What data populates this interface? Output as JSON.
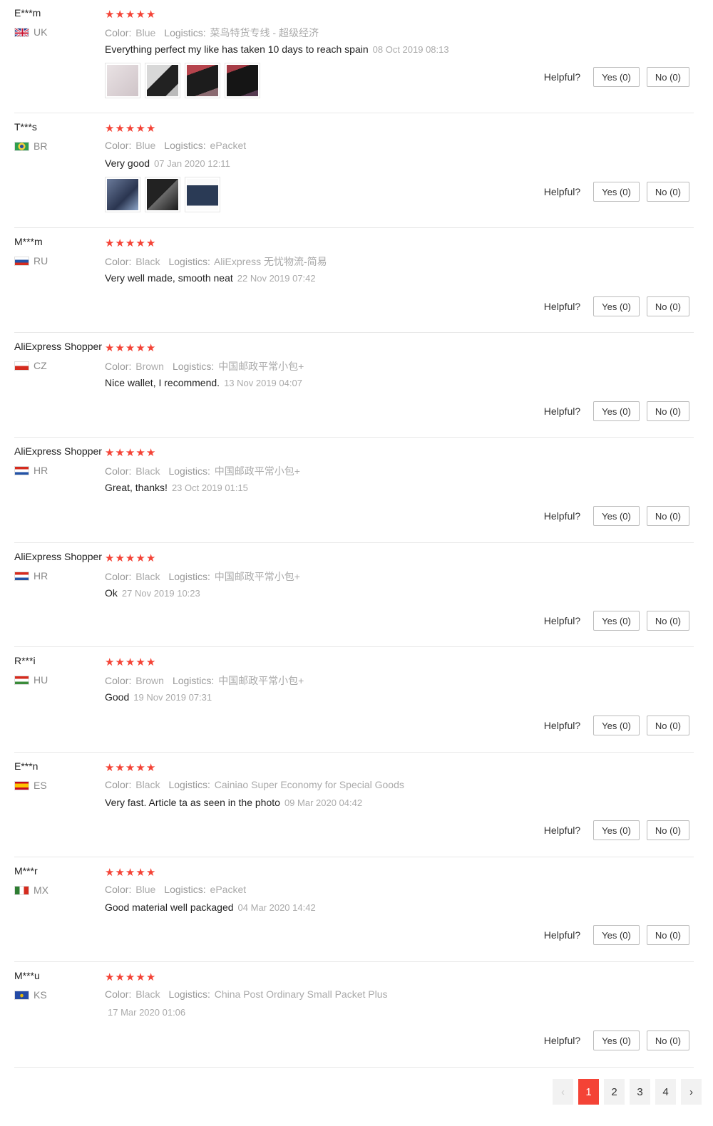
{
  "labels": {
    "color_label": "Color:",
    "logistics_label": "Logistics:",
    "helpful_label": "Helpful?"
  },
  "colors": {
    "star": "#f44336",
    "accent": "#f44336",
    "muted": "#aaaaaa"
  },
  "reviews": [
    {
      "user": "E***m",
      "country": "UK",
      "flag_icon": "uk-flag-icon",
      "stars": 5,
      "color": "Blue",
      "logistics": "菜鸟特货专线 - 超级经济",
      "text": "Everything perfect my like has taken 10 days to reach spain",
      "date": "08 Oct 2019 08:13",
      "photos": [
        "photo-1",
        "photo-2",
        "photo-3",
        "photo-4"
      ],
      "yes": "Yes (0)",
      "no": "No (0)"
    },
    {
      "user": "T***s",
      "country": "BR",
      "flag_icon": "br-flag-icon",
      "stars": 5,
      "color": "Blue",
      "logistics": "ePacket",
      "text": "Very good",
      "date": "07 Jan 2020 12:11",
      "photos": [
        "photo-1",
        "photo-2",
        "photo-3"
      ],
      "yes": "Yes (0)",
      "no": "No (0)"
    },
    {
      "user": "M***m",
      "country": "RU",
      "flag_icon": "ru-flag-icon",
      "stars": 5,
      "color": "Black",
      "logistics": "AliExpress 无忧物流-简易",
      "text": "Very well made, smooth neat",
      "date": "22 Nov 2019 07:42",
      "photos": [],
      "yes": "Yes (0)",
      "no": "No (0)"
    },
    {
      "user": "AliExpress Shopper",
      "country": "CZ",
      "flag_icon": "cz-flag-icon",
      "stars": 5,
      "color": "Brown",
      "logistics": "中国邮政平常小包+",
      "text": "Nice wallet, I recommend.",
      "date": "13 Nov 2019 04:07",
      "photos": [],
      "yes": "Yes (0)",
      "no": "No (0)"
    },
    {
      "user": "AliExpress Shopper",
      "country": "HR",
      "flag_icon": "hr-flag-icon",
      "stars": 5,
      "color": "Black",
      "logistics": "中国邮政平常小包+",
      "text": "Great, thanks!",
      "date": "23 Oct 2019 01:15",
      "photos": [],
      "yes": "Yes (0)",
      "no": "No (0)"
    },
    {
      "user": "AliExpress Shopper",
      "country": "HR",
      "flag_icon": "hr-flag-icon",
      "stars": 5,
      "color": "Black",
      "logistics": "中国邮政平常小包+",
      "text": "Ok",
      "date": "27 Nov 2019 10:23",
      "photos": [],
      "yes": "Yes (0)",
      "no": "No (0)"
    },
    {
      "user": "R***i",
      "country": "HU",
      "flag_icon": "hu-flag-icon",
      "stars": 5,
      "color": "Brown",
      "logistics": "中国邮政平常小包+",
      "text": "Good",
      "date": "19 Nov 2019 07:31",
      "photos": [],
      "yes": "Yes (0)",
      "no": "No (0)"
    },
    {
      "user": "E***n",
      "country": "ES",
      "flag_icon": "es-flag-icon",
      "stars": 5,
      "color": "Black",
      "logistics": "Cainiao Super Economy for Special Goods",
      "text": "Very fast. Article ta as seen in the photo",
      "date": "09 Mar 2020 04:42",
      "photos": [],
      "yes": "Yes (0)",
      "no": "No (0)"
    },
    {
      "user": "M***r",
      "country": "MX",
      "flag_icon": "mx-flag-icon",
      "stars": 5,
      "color": "Blue",
      "logistics": "ePacket",
      "text": "Good material well packaged",
      "date": "04 Mar 2020 14:42",
      "photos": [],
      "yes": "Yes (0)",
      "no": "No (0)"
    },
    {
      "user": "M***u",
      "country": "KS",
      "flag_icon": "ks-flag-icon",
      "stars": 5,
      "color": "Black",
      "logistics": "China Post Ordinary Small Packet Plus",
      "text": "",
      "date": "17 Mar 2020 01:06",
      "photos": [],
      "yes": "Yes (0)",
      "no": "No (0)"
    }
  ],
  "pagination": {
    "prev_icon": "chevron-left-icon",
    "next_icon": "chevron-right-icon",
    "prev_glyph": "‹",
    "next_glyph": "›",
    "pages": [
      "1",
      "2",
      "3",
      "4"
    ],
    "current": "1"
  }
}
